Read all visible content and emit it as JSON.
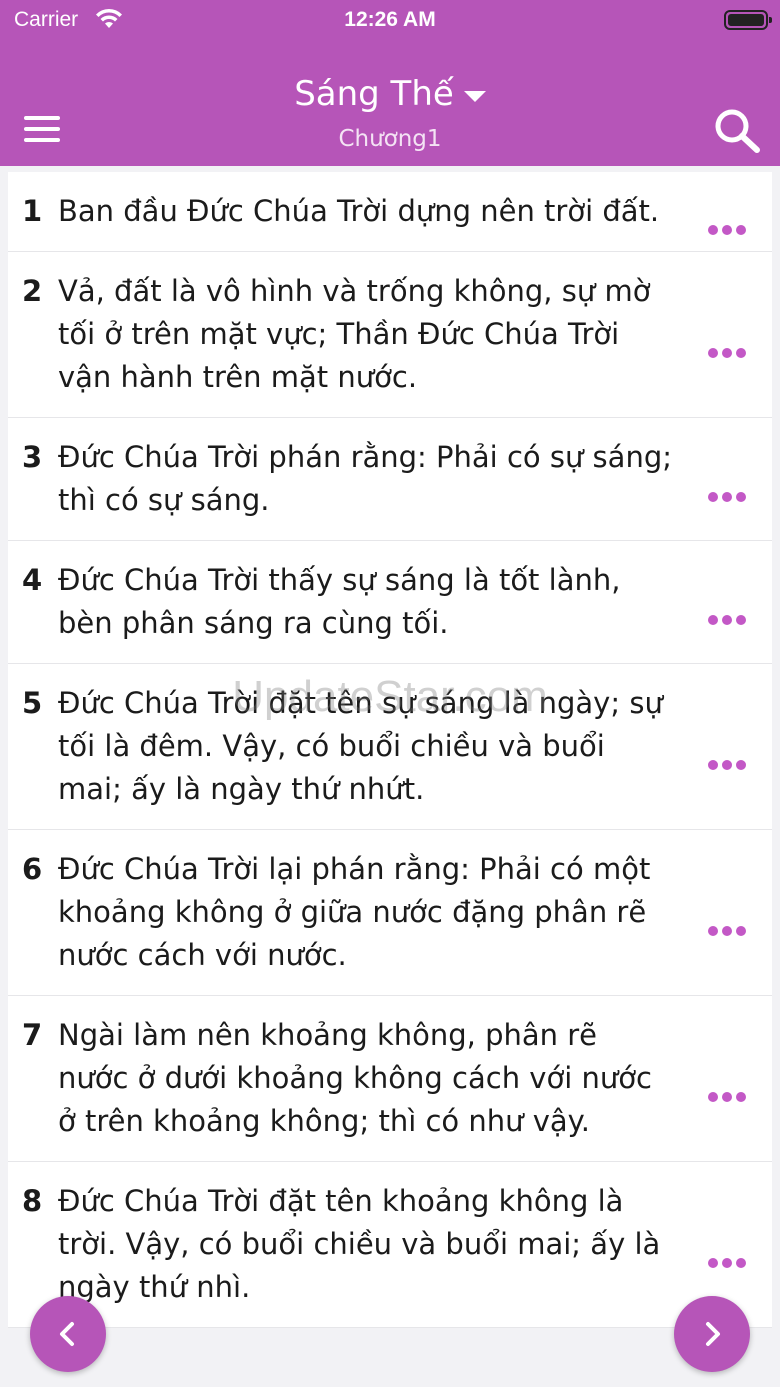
{
  "status_bar": {
    "carrier": "Carrier",
    "time": "12:26 AM"
  },
  "header": {
    "book_title": "Sáng Thế",
    "chapter": "Chương1",
    "background": "#b655b8"
  },
  "verses": [
    {
      "num": "1",
      "text": "Ban đầu Đức Chúa Trời dựng nên trời đất."
    },
    {
      "num": "2",
      "text": "Vả, đất là vô hình và trống không, sự mờ tối ở trên mặt vực; Thần Đức Chúa Trời vận hành trên mặt nước."
    },
    {
      "num": "3",
      "text": "Đức Chúa Trời phán rằng: Phải có sự sáng; thì có sự sáng."
    },
    {
      "num": "4",
      "text": "Đức Chúa Trời thấy sự sáng là tốt lành, bèn phân sáng ra cùng tối."
    },
    {
      "num": "5",
      "text": "Đức Chúa Trời đặt tên sự sáng là ngày; sự tối là đêm. Vậy, có buổi chiều và buổi mai; ấy là ngày thứ nhứt."
    },
    {
      "num": "6",
      "text": "Đức Chúa Trời lại phán rằng: Phải có một khoảng không ở giữa nước đặng phân rẽ nước cách với nước."
    },
    {
      "num": "7",
      "text": "Ngài làm nên khoảng không, phân rẽ nước ở dưới khoảng không cách với nước ở trên khoảng không; thì có như vậy."
    },
    {
      "num": "8",
      "text": "Đức Chúa Trời đặt tên khoảng không là trời. Vậy, có buổi chiều và buổi mai; ấy là ngày thứ nhì."
    }
  ],
  "watermark": "UpdateStar.com",
  "icons": {
    "menu": "hamburger-icon",
    "search": "search-icon",
    "more": "more-dots-icon",
    "prev": "chevron-left-icon",
    "next": "chevron-right-icon"
  },
  "accent": "#c358c6"
}
